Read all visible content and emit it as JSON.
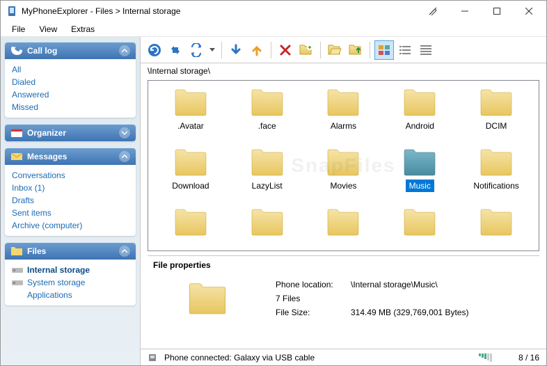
{
  "window": {
    "title": "MyPhoneExplorer -  Files > Internal storage"
  },
  "menu": {
    "file": "File",
    "view": "View",
    "extras": "Extras"
  },
  "sidebar": {
    "calllog": {
      "title": "Call log",
      "items": [
        "All",
        "Dialed",
        "Answered",
        "Missed"
      ]
    },
    "organizer": {
      "title": "Organizer"
    },
    "messages": {
      "title": "Messages",
      "items": [
        "Conversations",
        "Inbox (1)",
        "Drafts",
        "Sent items",
        "Archive (computer)"
      ]
    },
    "files": {
      "title": "Files",
      "items": [
        "Internal storage",
        "System storage",
        "Applications"
      ],
      "active_index": 0
    }
  },
  "path": "\\Internal storage\\",
  "folders": [
    {
      "name": ".Avatar",
      "selected": false
    },
    {
      "name": ".face",
      "selected": false
    },
    {
      "name": "Alarms",
      "selected": false
    },
    {
      "name": "Android",
      "selected": false
    },
    {
      "name": "DCIM",
      "selected": false
    },
    {
      "name": "Download",
      "selected": false
    },
    {
      "name": "LazyList",
      "selected": false
    },
    {
      "name": "Movies",
      "selected": false
    },
    {
      "name": "Music",
      "selected": true
    },
    {
      "name": "Notifications",
      "selected": false
    },
    {
      "name": "",
      "selected": false
    },
    {
      "name": "",
      "selected": false
    },
    {
      "name": "",
      "selected": false
    },
    {
      "name": "",
      "selected": false
    },
    {
      "name": "",
      "selected": false
    }
  ],
  "properties": {
    "title": "File properties",
    "location_label": "Phone location:",
    "location_value": "\\Internal storage\\Music\\",
    "files_count": "7 Files",
    "size_label": "File Size:",
    "size_value": "314.49 MB   (329,769,001 Bytes)"
  },
  "status": {
    "text": "Phone connected: Galaxy via USB cable",
    "position": "8 / 16"
  },
  "colors": {
    "folder_fill": "#f0d587",
    "folder_fill2": "#e8c65f",
    "folder_sel": "#5a9bb0",
    "link": "#1a6bb5"
  }
}
